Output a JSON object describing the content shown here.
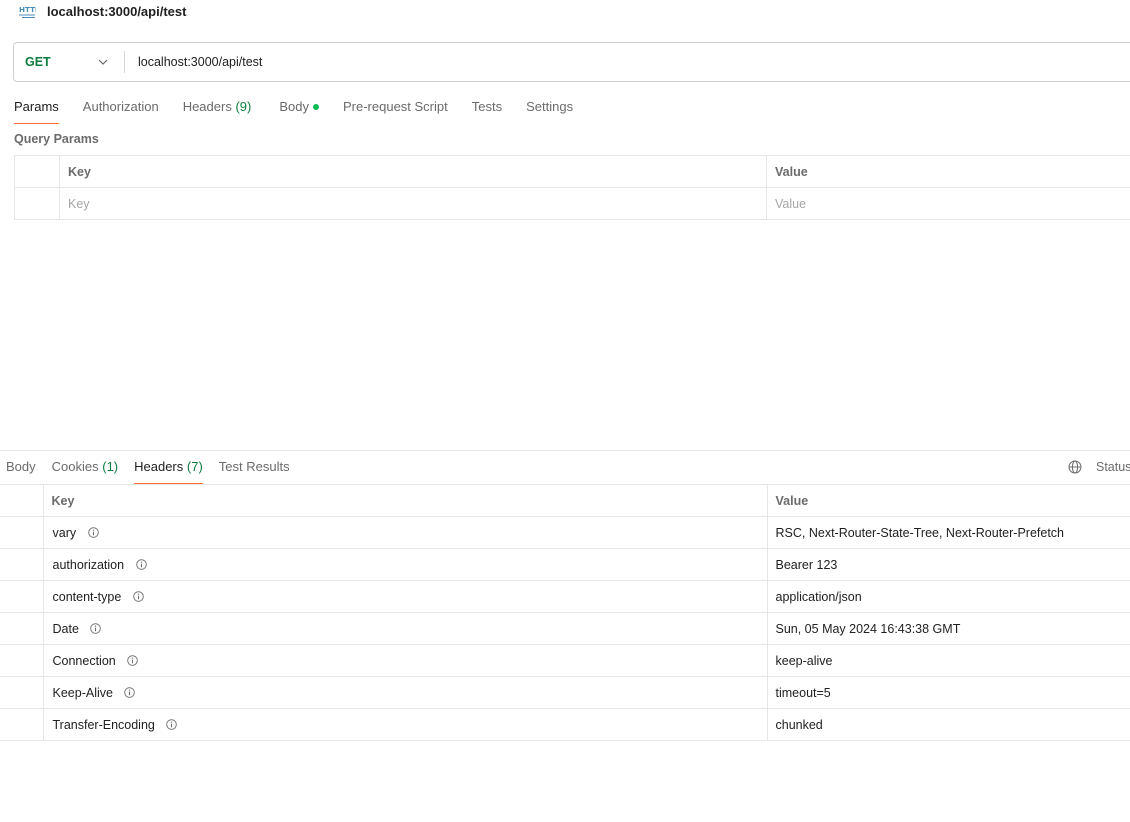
{
  "request": {
    "title": "localhost:3000/api/test",
    "method": "GET",
    "url": "localhost:3000/api/test",
    "tabs": [
      {
        "label": "Params",
        "active": true
      },
      {
        "label": "Authorization"
      },
      {
        "label": "Headers",
        "count": "(9)"
      },
      {
        "label": "Body"
      },
      {
        "label": "Pre-request Script"
      },
      {
        "label": "Tests"
      },
      {
        "label": "Settings"
      }
    ],
    "query_params": {
      "title": "Query Params",
      "key_header": "Key",
      "value_header": "Value",
      "key_placeholder": "Key",
      "value_placeholder": "Value"
    }
  },
  "response": {
    "tabs": [
      {
        "label": "Body"
      },
      {
        "label": "Cookies",
        "count": "(1)"
      },
      {
        "label": "Headers",
        "count": "(7)",
        "active": true
      },
      {
        "label": "Test Results"
      }
    ],
    "status_label": "Status",
    "headers": {
      "key_header": "Key",
      "value_header": "Value",
      "rows": [
        {
          "key": "vary",
          "value": "RSC, Next-Router-State-Tree, Next-Router-Prefetch"
        },
        {
          "key": "authorization",
          "value": "Bearer 123"
        },
        {
          "key": "content-type",
          "value": "application/json"
        },
        {
          "key": "Date",
          "value": "Sun, 05 May 2024 16:43:38 GMT"
        },
        {
          "key": "Connection",
          "value": "keep-alive"
        },
        {
          "key": "Keep-Alive",
          "value": "timeout=5"
        },
        {
          "key": "Transfer-Encoding",
          "value": "chunked"
        }
      ]
    }
  },
  "icons": {
    "http": "http-icon",
    "method_dropdown": "chevron-down-icon",
    "body_status": "green-dot-icon",
    "globe": "globe-icon",
    "info": "info-icon"
  },
  "colors": {
    "accent": "#ff6c37",
    "method": "#0b7d3e",
    "count": "#0b7d3e",
    "dot": "#0cbb52",
    "http_icon": "#4c8db8"
  }
}
